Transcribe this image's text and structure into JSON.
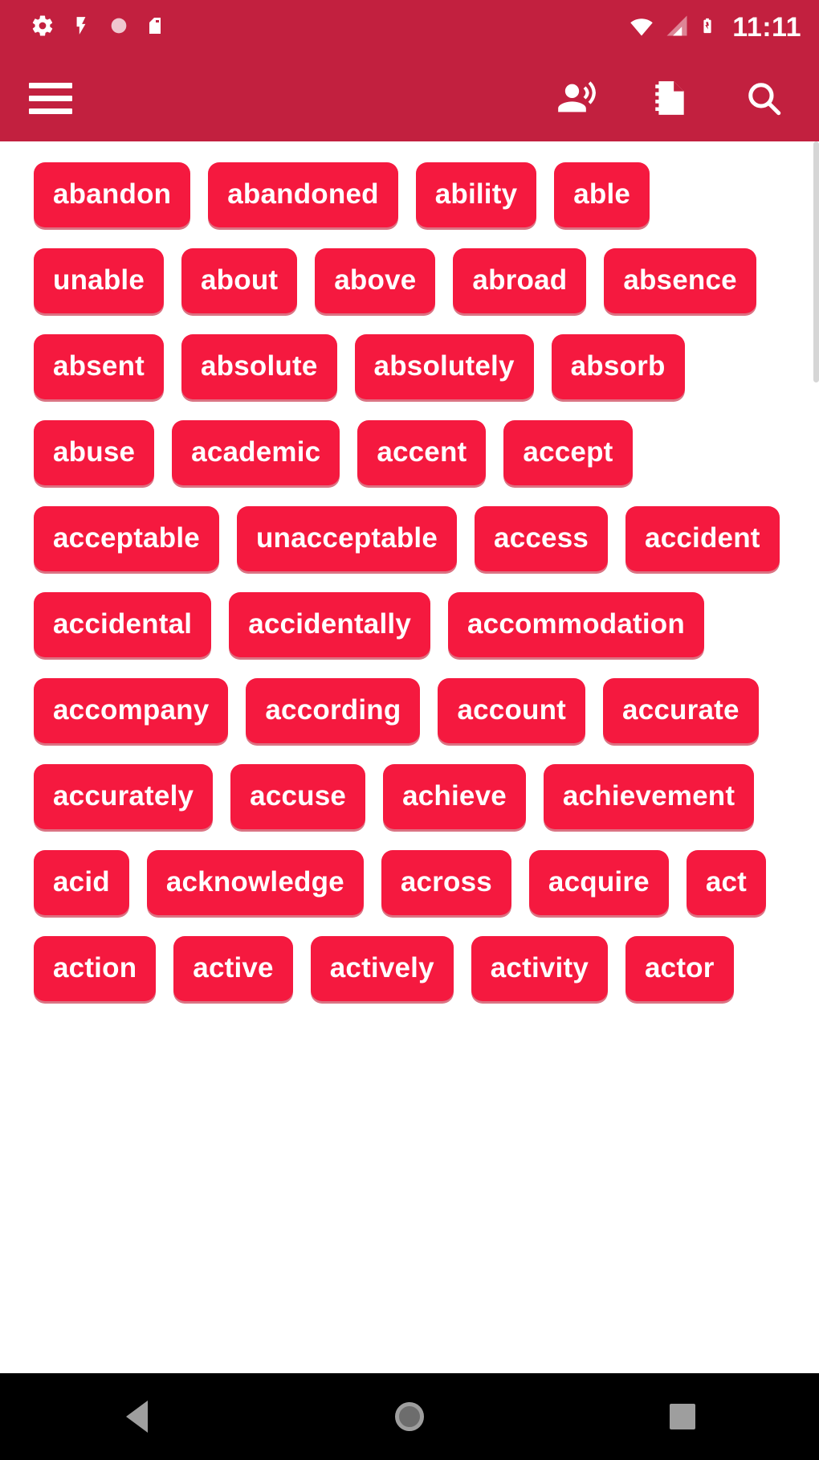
{
  "status_bar": {
    "time": "11:11",
    "left_icons": [
      "settings-gear-icon",
      "flash-icon",
      "circle-icon",
      "sim-card-icon"
    ],
    "right_icons": [
      "wifi-icon",
      "cellular-signal-icon",
      "battery-icon"
    ],
    "background_color": "#c2203f"
  },
  "app_bar": {
    "menu_label": "Menu",
    "actions": [
      {
        "name": "record-voice-icon",
        "label": "Pronounce"
      },
      {
        "name": "notebook-icon",
        "label": "Notebook"
      },
      {
        "name": "search-icon",
        "label": "Search"
      }
    ],
    "background_color": "#c2203f"
  },
  "word_list": {
    "chip_color": "#f5193f",
    "chip_text_color": "#ffffff",
    "words": [
      "abandon",
      "abandoned",
      "ability",
      "able",
      "unable",
      "about",
      "above",
      "abroad",
      "absence",
      "absent",
      "absolute",
      "absolutely",
      "absorb",
      "abuse",
      "academic",
      "accent",
      "accept",
      "acceptable",
      "unacceptable",
      "access",
      "accident",
      "accidental",
      "accidentally",
      "accommodation",
      "accompany",
      "according",
      "account",
      "accurate",
      "accurately",
      "accuse",
      "achieve",
      "achievement",
      "acid",
      "acknowledge",
      "across",
      "acquire",
      "act",
      "action",
      "active",
      "actively",
      "activity",
      "actor"
    ]
  },
  "nav_bar": {
    "background_color": "#000000",
    "buttons": [
      {
        "name": "nav-back-button",
        "label": "Back"
      },
      {
        "name": "nav-home-button",
        "label": "Home"
      },
      {
        "name": "nav-recents-button",
        "label": "Recents"
      }
    ]
  }
}
